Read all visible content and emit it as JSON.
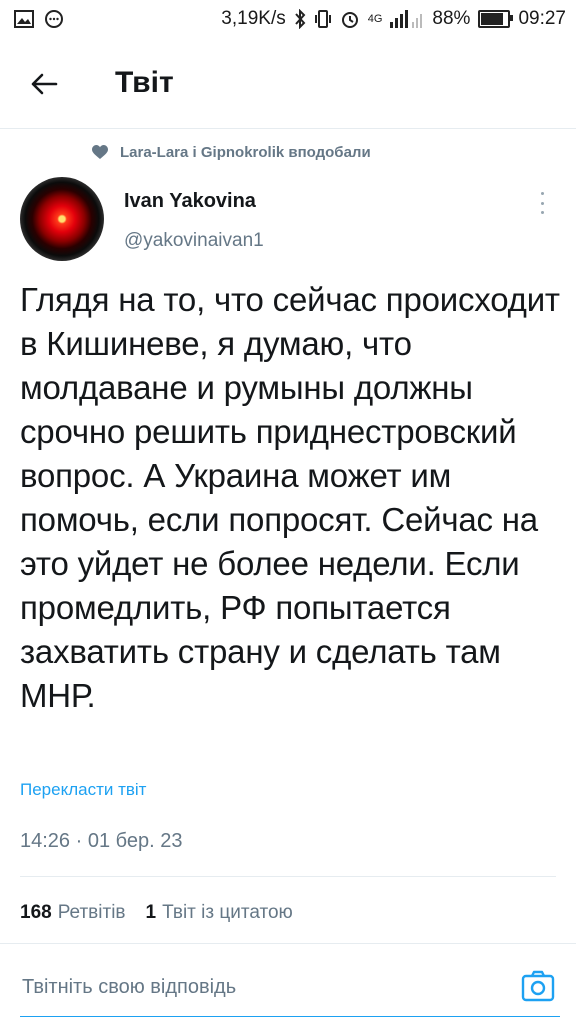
{
  "status_bar": {
    "network_speed": "3,19K/s",
    "network_type": "4G",
    "battery_percent": "88%",
    "battery_level": 0.88,
    "time": "09:27",
    "icons": [
      "gallery-icon",
      "chat-icon",
      "bluetooth-icon",
      "vibrate-icon",
      "alarm-icon",
      "signal-icon",
      "battery-icon"
    ]
  },
  "header": {
    "back_icon": "arrow-left-icon",
    "title": "Твіт"
  },
  "tweet": {
    "social_context": "Lara-Lara і Gipnokrolik вподобали",
    "author_name": "Ivan Yakovina",
    "author_handle": "@yakovinaivan1",
    "text": "Глядя на то, что сейчас происходит в Кишиневе, я думаю, что молдаване и румыны должны срочно решить приднестровский вопрос. А Украина может им помочь, если попросят. Сейчас на это уйдет не более недели. Если промедлить, РФ попытается захватить страну и сделать там МНР.",
    "translate_label": "Перекласти твіт",
    "timestamp": "14:26 · 01 бер. 23",
    "retweets_count": "168",
    "retweets_label": "Ретвітів",
    "quotes_count": "1",
    "quotes_label": "Твіт із цитатою"
  },
  "reply": {
    "placeholder": "Твітніть свою відповідь"
  },
  "colors": {
    "accent": "#1da1f2",
    "text": "#14171a",
    "secondary": "#657786",
    "divider": "#e6ecf0"
  }
}
